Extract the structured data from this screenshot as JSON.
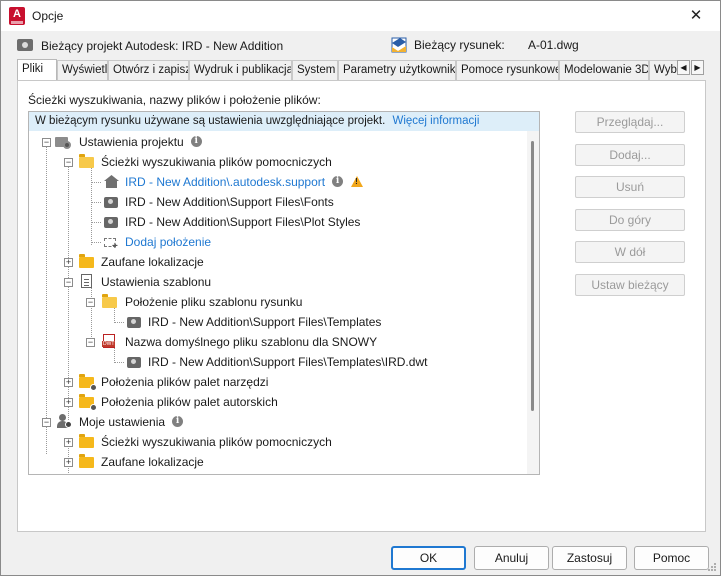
{
  "window": {
    "title": "Opcje",
    "close_glyph": "✕"
  },
  "header": {
    "project_label": "Bieżący projekt Autodesk: IRD - New Addition",
    "drawing_label": "Bieżący rysunek:",
    "drawing_value": "A-01.dwg"
  },
  "tabs": [
    {
      "label": "Pliki",
      "active": true
    },
    {
      "label": "Wyświetl",
      "active": false
    },
    {
      "label": "Otwórz i zapisz",
      "active": false
    },
    {
      "label": "Wydruk i publikacja",
      "active": false
    },
    {
      "label": "System",
      "active": false
    },
    {
      "label": "Parametry użytkownika",
      "active": false
    },
    {
      "label": "Pomoce rysunkowe",
      "active": false
    },
    {
      "label": "Modelowanie 3D",
      "active": false
    },
    {
      "label": "Wybór",
      "active": false
    }
  ],
  "tab_scroll": {
    "left": "◀",
    "right": "▶"
  },
  "panel": {
    "caption": "Ścieżki wyszukiwania, nazwy plików i położenie plików:",
    "banner_text": "W bieżącym rysunku używane są ustawienia uwzględniające projekt.",
    "banner_link": "Więcej informacji"
  },
  "tree": {
    "project_settings": "Ustawienia projektu",
    "support_paths": "Ścieżki wyszukiwania plików pomocniczych",
    "support_item_1": "IRD - New Addition\\.autodesk.support",
    "support_item_2": "IRD - New Addition\\Support Files\\Fonts",
    "support_item_3": "IRD - New Addition\\Support Files\\Plot Styles",
    "add_location": "Dodaj położenie",
    "trusted_locations": "Zaufane lokalizacje",
    "template_settings": "Ustawienia szablonu",
    "template_location": "Położenie pliku szablonu rysunku",
    "template_location_item": "IRD - New Addition\\Support Files\\Templates",
    "default_template": "Nazwa domyślnego pliku szablonu dla SNOWY",
    "default_template_item": "IRD - New Addition\\Support Files\\Templates\\IRD.dwt",
    "tool_palettes": "Położenia plików palet narzędzi",
    "authoring_palettes": "Położenia plików palet autorskich",
    "my_settings": "Moje ustawienia",
    "my_support_paths": "Ścieżki wyszukiwania plików pomocniczych",
    "my_trusted_locations": "Zaufane lokalizacje",
    "info_glyph": "i",
    "warn_glyph": "!"
  },
  "side_buttons": {
    "browse": "Przeglądaj...",
    "add": "Dodaj...",
    "remove": "Usuń",
    "move_up": "Do góry",
    "move_down": "W dół",
    "set_current": "Ustaw bieżący"
  },
  "footer": {
    "ok": "OK",
    "cancel": "Anuluj",
    "apply": "Zastosuj",
    "help": "Pomoc"
  },
  "colors": {
    "link": "#1f78d1",
    "banner_bg": "#ddeef9",
    "folder": "#f5b81c",
    "warning": "#f2a71b"
  }
}
